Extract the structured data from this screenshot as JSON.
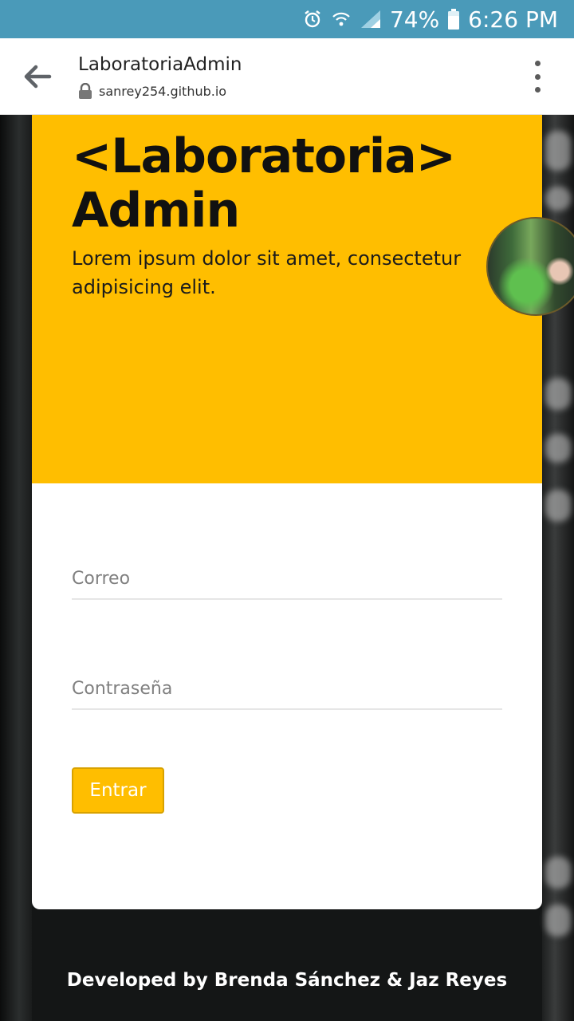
{
  "status_bar": {
    "battery": "74%",
    "time": "6:26 PM",
    "icons": [
      "alarm-icon",
      "wifi-icon",
      "signal-icon",
      "battery-icon"
    ],
    "background": "#4a9ab9"
  },
  "browser": {
    "title": "LaboratoriaAdmin",
    "url": "sanrey254.github.io",
    "icons": [
      "back-arrow-icon",
      "lock-icon",
      "more-vert-icon"
    ]
  },
  "hero": {
    "title_line1": "<Laboratoria>",
    "title_line2": "Admin",
    "subtitle": "Lorem ipsum dolor sit amet, consectetur adipisicing elit.",
    "accent": "#ffbe00"
  },
  "login": {
    "email_placeholder": "Correo",
    "password_placeholder": "Contraseña",
    "submit_label": "Entrar"
  },
  "footer": {
    "credits": "Developed by Brenda Sánchez & Jaz Reyes"
  }
}
